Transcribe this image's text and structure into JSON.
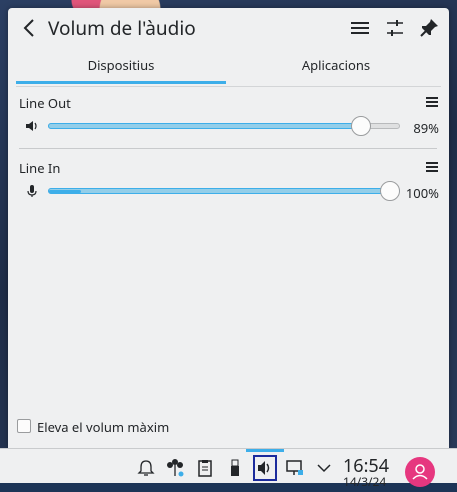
{
  "popup": {
    "title": "Volum de l'àudio",
    "tabs": [
      {
        "label": "Dispositius",
        "active": true
      },
      {
        "label": "Aplicacions",
        "active": false
      }
    ],
    "devices": [
      {
        "name": "Line Out",
        "icon": "speaker-icon",
        "volume_percent": 89,
        "volume_label": "89%",
        "peak_percent": 0
      },
      {
        "name": "Line In",
        "icon": "microphone-icon",
        "volume_percent": 100,
        "volume_label": "100%",
        "peak_percent": 9
      }
    ],
    "raise_max_volume_label": "Eleva el volum màxim",
    "raise_max_volume_checked": false
  },
  "taskbar": {
    "icons": [
      "notifications-icon",
      "network-icon",
      "clipboard-icon",
      "removable-device-icon",
      "volume-icon",
      "display-icon",
      "expand-tray-icon"
    ],
    "clock_time": "16:54",
    "clock_date": "14/3/24"
  },
  "colors": {
    "accent": "#3daee9",
    "avatar": "#e6377f",
    "background": "#eff0f1"
  }
}
